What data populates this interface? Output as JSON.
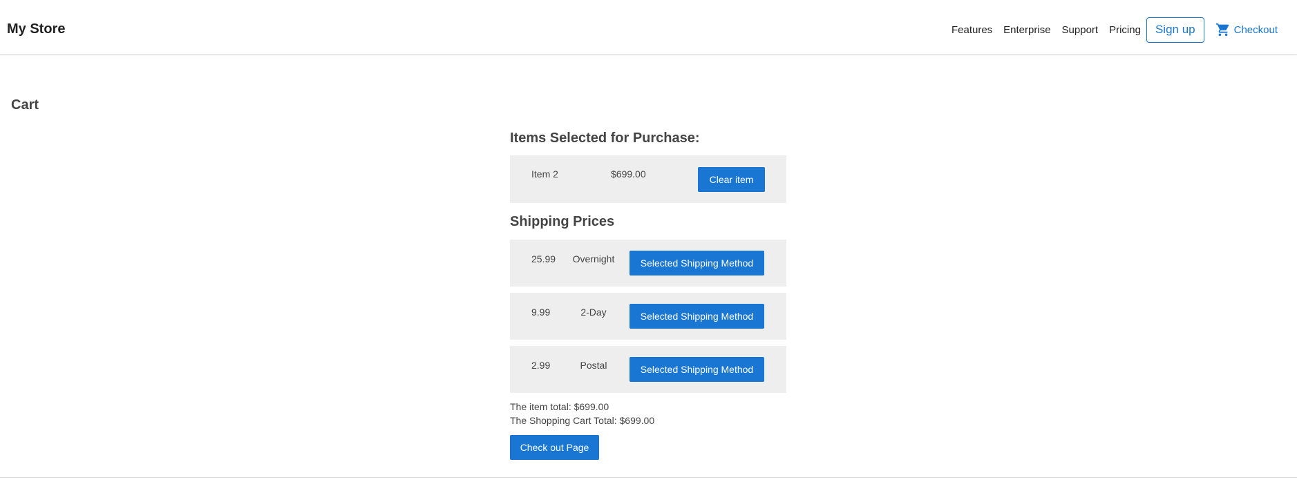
{
  "header": {
    "brand": "My Store",
    "nav": {
      "features": "Features",
      "enterprise": "Enterprise",
      "support": "Support",
      "pricing": "Pricing"
    },
    "signup_label": "Sign up",
    "checkout_label": "Checkout",
    "checkout_icon": "shopping-cart-icon"
  },
  "page": {
    "title": "Cart"
  },
  "cart": {
    "items_heading": "Items Selected for Purchase:",
    "items": [
      {
        "name": "Item 2",
        "price": "$699.00",
        "clear_label": "Clear item"
      }
    ]
  },
  "shipping": {
    "heading": "Shipping Prices",
    "options": [
      {
        "price": "25.99",
        "method": "Overnight",
        "button_label": "Selected Shipping Method"
      },
      {
        "price": "9.99",
        "method": "2-Day",
        "button_label": "Selected Shipping Method"
      },
      {
        "price": "2.99",
        "method": "Postal",
        "button_label": "Selected Shipping Method"
      }
    ]
  },
  "totals": {
    "item_total": "The item total: $699.00",
    "cart_total": "The Shopping Cart Total: $699.00"
  },
  "checkout_page_label": "Check out Page",
  "colors": {
    "accent": "#1976d2",
    "row_background": "#eeeeee"
  }
}
